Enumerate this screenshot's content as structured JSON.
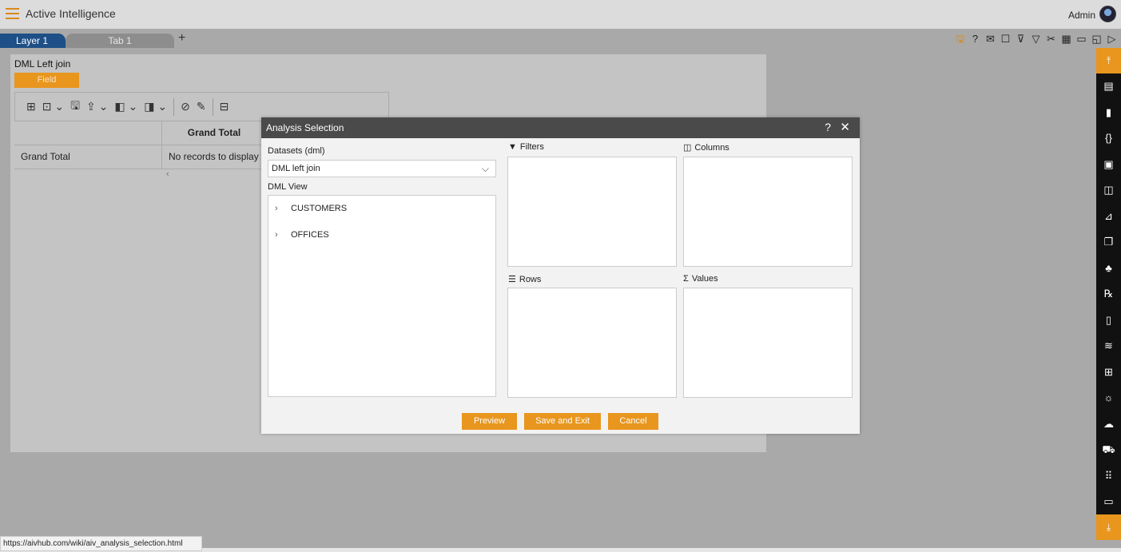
{
  "header": {
    "app_title": "Active Intelligence",
    "user": "Admin"
  },
  "tabs": {
    "layer": "Layer 1",
    "tab1": "Tab 1",
    "add": "+"
  },
  "report": {
    "title": "DML Left join",
    "field_button": "Field",
    "grid": {
      "header": [
        "",
        "Grand Total"
      ],
      "row": [
        "Grand Total",
        "No records to display"
      ]
    }
  },
  "dialog": {
    "title": "Analysis Selection",
    "help": "?",
    "close": "✕",
    "datasets_label": "Datasets (dml)",
    "datasets_value": "DML left join",
    "dml_view_label": "DML View",
    "tree_items": [
      "CUSTOMERS",
      "OFFICES"
    ],
    "filters_label": "Filters",
    "columns_label": "Columns",
    "rows_label": "Rows",
    "values_label": "Values",
    "buttons": {
      "preview": "Preview",
      "save_exit": "Save and Exit",
      "cancel": "Cancel"
    }
  },
  "status_url": "https://aivhub.com/wiki/aiv_analysis_selection.html",
  "colors": {
    "accent": "#e8961e",
    "tab_active": "#1e4f86",
    "dialog_header": "#4a4a4a"
  }
}
